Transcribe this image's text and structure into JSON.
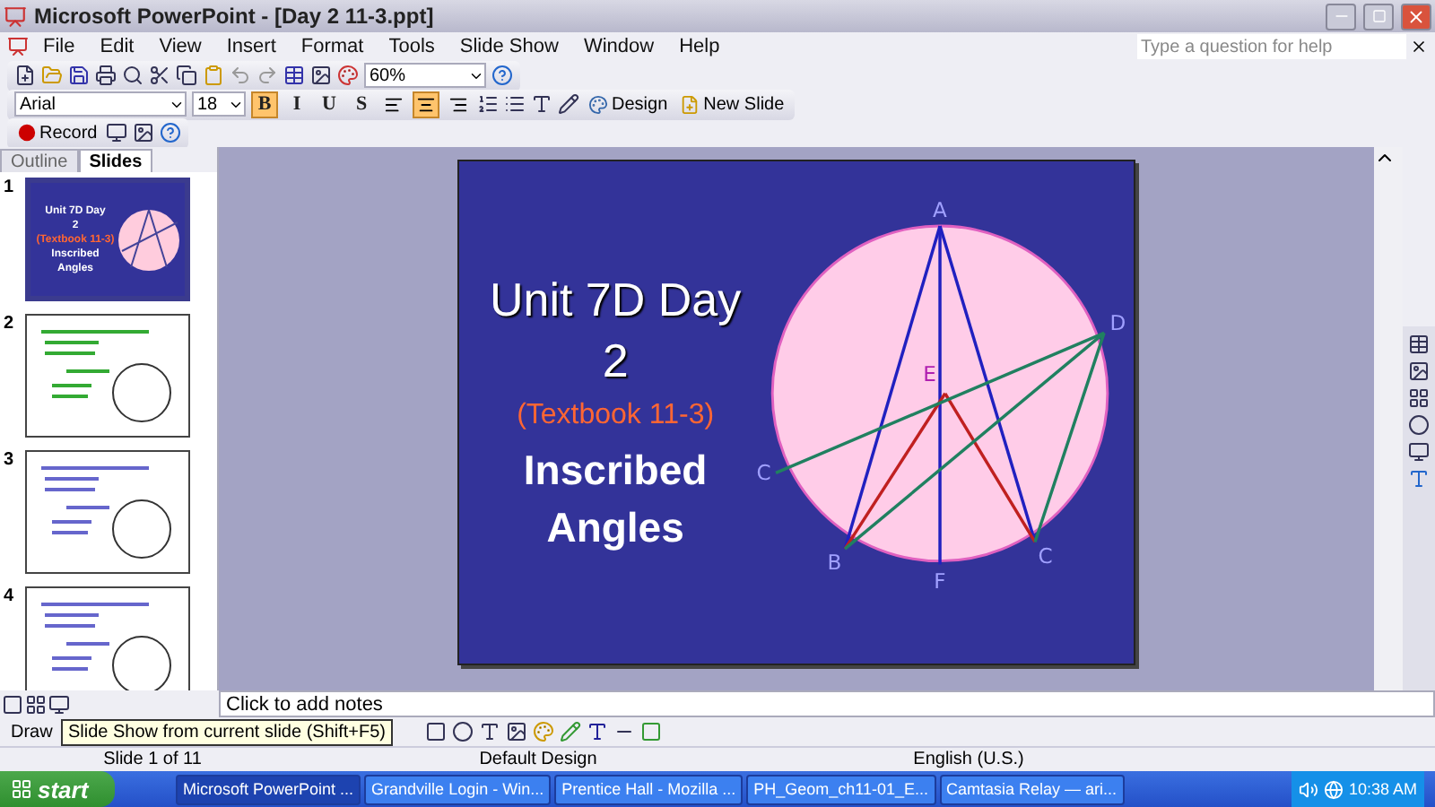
{
  "window": {
    "title": "Microsoft PowerPoint - [Day 2 11-3.ppt]"
  },
  "menu": [
    "File",
    "Edit",
    "View",
    "Insert",
    "Format",
    "Tools",
    "Slide Show",
    "Window",
    "Help"
  ],
  "help_box": {
    "placeholder": "Type a question for help"
  },
  "standard_toolbar": {
    "zoom": "60%"
  },
  "formatting_toolbar": {
    "font": "Arial",
    "size": "18",
    "styles": [
      {
        "label": "B",
        "selected": true
      },
      {
        "label": "I",
        "selected": false
      },
      {
        "label": "U",
        "selected": false
      },
      {
        "label": "S",
        "selected": false
      }
    ],
    "alignment": [
      {
        "selected": false
      },
      {
        "selected": true
      },
      {
        "selected": false
      }
    ],
    "design": "Design",
    "new_slide": "New Slide"
  },
  "record_toolbar": {
    "record": "Record"
  },
  "panel_tabs": [
    {
      "label": "Outline",
      "selected": false
    },
    {
      "label": "Slides",
      "selected": true
    }
  ],
  "thumbnails": [
    {
      "number": "1",
      "selected": true,
      "kind": "title",
      "lines": [
        "Unit 7D Day",
        "2",
        "(Textbook 11-3)",
        "Inscribed",
        "Angles"
      ]
    },
    {
      "number": "2",
      "selected": false,
      "kind": "content"
    },
    {
      "number": "3",
      "selected": false,
      "kind": "content"
    },
    {
      "number": "4",
      "selected": false,
      "kind": "content"
    }
  ],
  "slide": {
    "title_lines": [
      "Unit 7D Day",
      "2"
    ],
    "subtitle": "(Textbook 11-3)",
    "heading_lines": [
      "Inscribed",
      "Angles"
    ],
    "points": [
      {
        "label": "A"
      },
      {
        "label": "D"
      },
      {
        "label": "C"
      },
      {
        "label": "F"
      },
      {
        "label": "B"
      },
      {
        "label": "C"
      },
      {
        "label": "E"
      }
    ]
  },
  "notes": {
    "placeholder": "Click to add notes"
  },
  "draw_toolbar": {
    "draw": "Draw"
  },
  "tooltip": "Slide Show from current slide (Shift+F5)",
  "status_bar": [
    "Slide 1 of 11",
    "Default Design",
    "English (U.S.)"
  ],
  "taskbar": {
    "start": "start",
    "tasks": [
      {
        "label": "Microsoft PowerPoint ...",
        "selected": true
      },
      {
        "label": "Grandville Login - Win...",
        "selected": false
      },
      {
        "label": "Prentice Hall - Mozilla ...",
        "selected": false
      },
      {
        "label": "PH_Geom_ch11-01_E...",
        "selected": false
      },
      {
        "label": "Camtasia Relay — ari...",
        "selected": false
      }
    ],
    "clock": "10:38 AM"
  }
}
